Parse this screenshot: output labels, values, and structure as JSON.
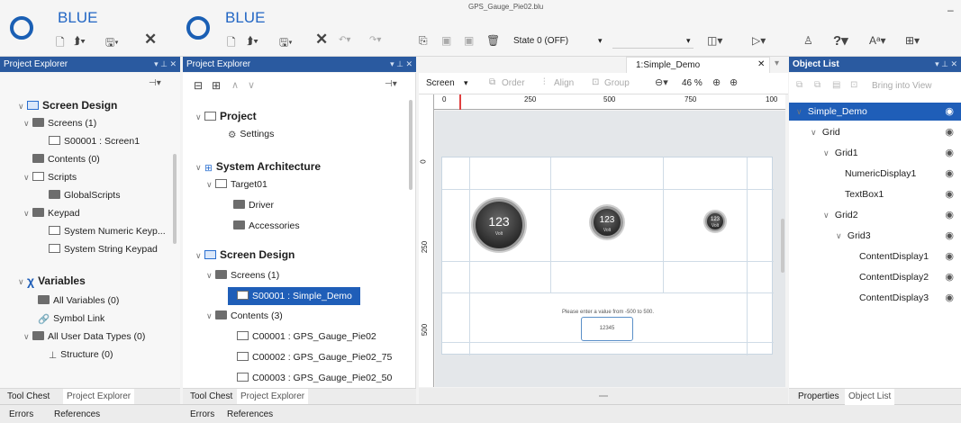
{
  "window_title": "GPS_Gauge_Pie02.blu",
  "brand": "BLUE",
  "toolbar": {
    "state_select": "State 0 (OFF)"
  },
  "left_panel": {
    "title": "Project Explorer",
    "items": [
      {
        "label": "Screen Design",
        "bold": true
      },
      {
        "label": "Screens (1)"
      },
      {
        "label": "S00001 : Screen1"
      },
      {
        "label": "Contents (0)"
      },
      {
        "label": "Scripts"
      },
      {
        "label": "GlobalScripts"
      },
      {
        "label": "Keypad"
      },
      {
        "label": "System Numeric Keyp..."
      },
      {
        "label": "System String Keypad"
      },
      {
        "label": "Variables",
        "bold": true
      },
      {
        "label": "All Variables (0)"
      },
      {
        "label": "Symbol Link"
      },
      {
        "label": "All User Data Types (0)"
      },
      {
        "label": "Structure (0)"
      }
    ],
    "bottom_tabs": [
      "Tool Chest",
      "Project Explorer"
    ]
  },
  "mid_panel": {
    "title": "Project Explorer",
    "items": [
      {
        "label": "Project",
        "bold": true
      },
      {
        "label": "Settings"
      },
      {
        "label": "System Architecture",
        "bold": true
      },
      {
        "label": "Target01"
      },
      {
        "label": "Driver"
      },
      {
        "label": "Accessories"
      },
      {
        "label": "Screen Design",
        "bold": true
      },
      {
        "label": "Screens (1)"
      },
      {
        "label": "S00001 : Simple_Demo"
      },
      {
        "label": "Contents (3)"
      },
      {
        "label": "C00001 : GPS_Gauge_Pie02"
      },
      {
        "label": "C00002 : GPS_Gauge_Pie02_75"
      },
      {
        "label": "C00003 : GPS_Gauge_Pie02_50"
      }
    ],
    "bottom_tabs": [
      "Tool Chest",
      "Project Explorer"
    ]
  },
  "bottom_bar": [
    "Errors",
    "References"
  ],
  "editor": {
    "tab": "1:Simple_Demo",
    "screen_btn": "Screen",
    "order": "Order",
    "align": "Align",
    "group": "Group",
    "zoom": "46 %",
    "ruler_h": [
      "0",
      "250",
      "500",
      "750",
      "100"
    ],
    "ruler_v": [
      "0",
      "250",
      "500"
    ],
    "gauges": [
      {
        "value": "123",
        "unit": "Volt"
      },
      {
        "value": "123",
        "unit": "Volt"
      },
      {
        "value": "123",
        "unit": "Volt"
      }
    ],
    "prompt": "Please enter a value from -500 to 500.",
    "input_value": "12345"
  },
  "object_list": {
    "title": "Object List",
    "bring_btn": "Bring into View",
    "items": [
      {
        "label": "Simple_Demo",
        "indent": 0
      },
      {
        "label": "Grid",
        "indent": 1
      },
      {
        "label": "Grid1",
        "indent": 2
      },
      {
        "label": "NumericDisplay1",
        "indent": 3
      },
      {
        "label": "TextBox1",
        "indent": 3
      },
      {
        "label": "Grid2",
        "indent": 2
      },
      {
        "label": "Grid3",
        "indent": 3
      },
      {
        "label": "ContentDisplay1",
        "indent": 4
      },
      {
        "label": "ContentDisplay2",
        "indent": 4
      },
      {
        "label": "ContentDisplay3",
        "indent": 4
      }
    ],
    "bottom_tabs": [
      "Properties",
      "Object List"
    ]
  }
}
